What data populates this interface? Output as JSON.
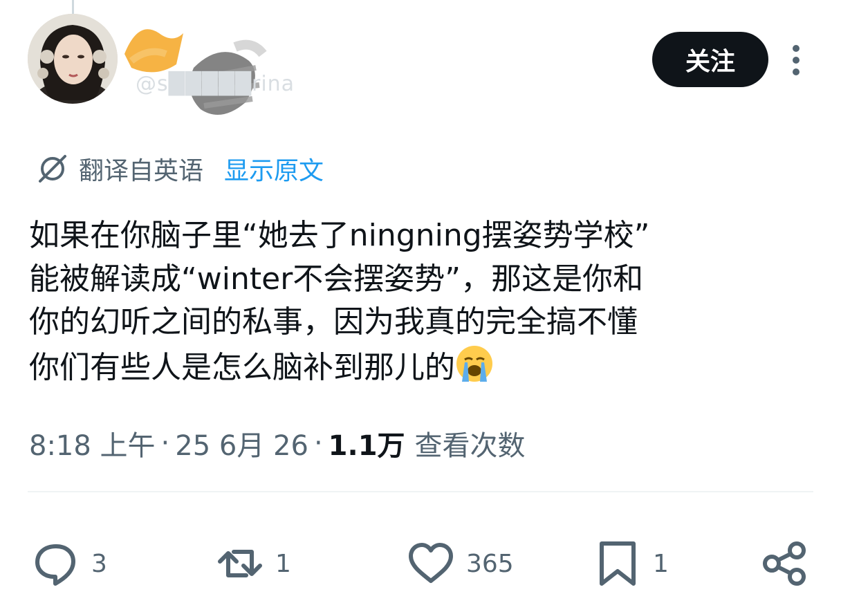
{
  "user": {
    "handle": "@s█████rina",
    "follow_label": "关注"
  },
  "icons": {
    "more": "more-vertical-icon",
    "translate": "translate-icon",
    "reply": "reply-icon",
    "repost": "repost-icon",
    "like": "heart-icon",
    "bookmark": "bookmark-icon",
    "share": "share-icon",
    "emoji": "loudly-crying-face-emoji"
  },
  "translation": {
    "label": "翻译自英语",
    "show_original": "显示原文"
  },
  "tweet": {
    "text": "如果在你脑子里“她去了ningning摆姿势学校”\n能被解读成“winter不会摆姿势”，那这是你和\n你的幻听之间的私事，因为我真的完全搞不懂\n你们有些人是怎么脑补到那儿的"
  },
  "meta": {
    "time": "8:18 上午",
    "separator": "·",
    "date": "25 6月 26",
    "views_count": "1.1万",
    "views_label": "查看次数"
  },
  "actions": {
    "replies": "3",
    "reposts": "1",
    "likes": "365",
    "bookmarks": "1"
  },
  "colors": {
    "text_primary": "#0f1419",
    "text_secondary": "#536471",
    "link": "#1d9bf0",
    "divider": "#eff3f4",
    "button_bg": "#0f1419"
  }
}
